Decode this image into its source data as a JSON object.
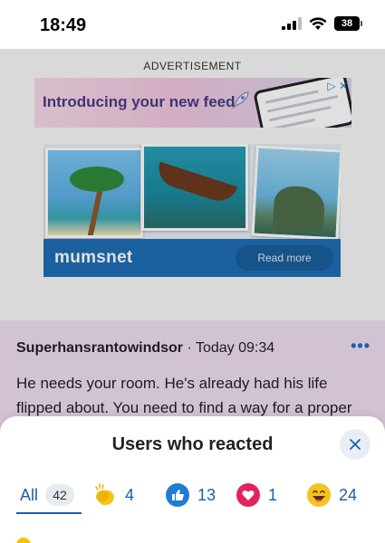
{
  "status_bar": {
    "time": "18:49",
    "battery": "38"
  },
  "advertisement": {
    "label": "ADVERTISEMENT",
    "banner_text": "Introducing your new feed",
    "brand": "mumsnet",
    "cta": "Read more"
  },
  "post": {
    "author": "Superhansrantowindsor",
    "separator": "·",
    "time": "Today 09:34",
    "more": "•••",
    "body": "He needs your room. He's already had his life flipped about. You need to find a way for a proper"
  },
  "sheet": {
    "title": "Users who reacted",
    "close_icon": "close-icon",
    "tabs": [
      {
        "label": "All",
        "count": "42",
        "icon": ""
      },
      {
        "label": "",
        "count": "4",
        "icon": "clap-icon"
      },
      {
        "label": "",
        "count": "13",
        "icon": "thumbs-up-icon"
      },
      {
        "label": "",
        "count": "1",
        "icon": "heart-icon"
      },
      {
        "label": "",
        "count": "24",
        "icon": "laughing-icon"
      }
    ],
    "active_tab": "All"
  },
  "colors": {
    "accent": "#1d5fa8",
    "mumsnet_blue": "#1f6fb6",
    "post_bg": "#f0dff0",
    "heart": "#e0245e",
    "thumbs": "#1f7bd3",
    "emoji_yellow": "#f7c21a"
  }
}
